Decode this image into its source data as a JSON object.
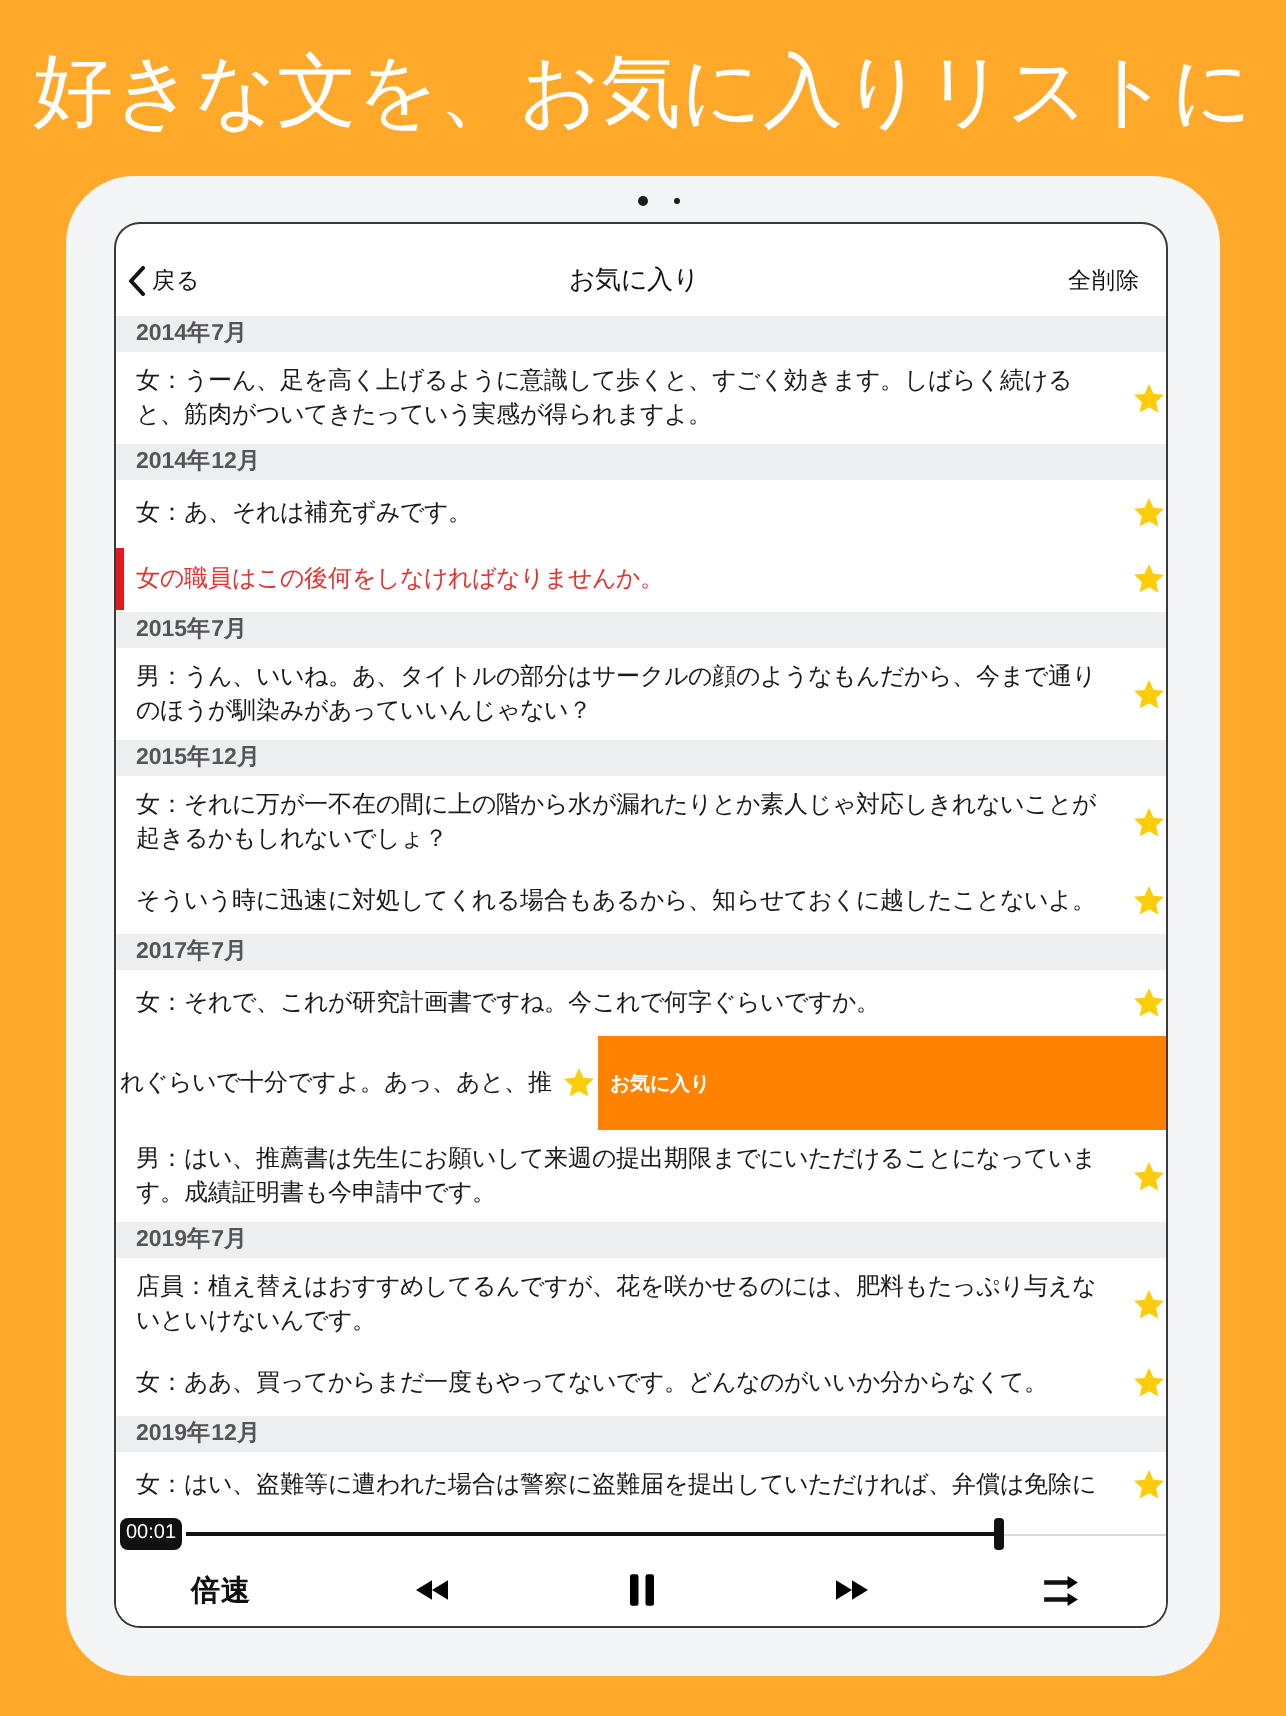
{
  "headline": "好きな文を、お気に入りリストに",
  "nav": {
    "back": "戻る",
    "title": "お気に入り",
    "action": "全削除"
  },
  "sections": [
    {
      "title": "2014年7月",
      "items": [
        {
          "kind": "row",
          "text": "女：うーん、足を高く上げるように意識して歩くと、すごく効きます。しばらく続けると、筋肉がついてきたっていう実感が得られますよ。",
          "favorite": true,
          "playing": false
        }
      ]
    },
    {
      "title": "2014年12月",
      "items": [
        {
          "kind": "row",
          "text": "女：あ、それは補充ずみです。",
          "favorite": true,
          "playing": false
        },
        {
          "kind": "row",
          "text": "女の職員はこの後何をしなければなりませんか。",
          "favorite": true,
          "playing": true
        }
      ]
    },
    {
      "title": "2015年7月",
      "items": [
        {
          "kind": "row",
          "text": "男：うん、いいね。あ、タイトルの部分はサークルの顔のようなもんだから、今まで通りのほうが馴染みがあっていいんじゃない？",
          "favorite": true,
          "playing": false
        }
      ]
    },
    {
      "title": "2015年12月",
      "items": [
        {
          "kind": "row",
          "text": "女：それに万が一不在の間に上の階から水が漏れたりとか素人じゃ対応しきれないことが起きるかもしれないでしょ？",
          "favorite": true,
          "playing": false
        },
        {
          "kind": "row",
          "text": "そういう時に迅速に対処してくれる場合もあるから、知らせておくに越したことないよ。",
          "favorite": true,
          "playing": false
        }
      ]
    },
    {
      "title": "2017年7月",
      "items": [
        {
          "kind": "row",
          "text": "女：それで、これが研究計画書ですね。今これで何字ぐらいですか。",
          "favorite": true,
          "playing": false
        },
        {
          "kind": "swiped",
          "text": "れぐらいで十分ですよ。あっ、あと、推",
          "action": "お気に入り",
          "favorite": true,
          "playing": false
        },
        {
          "kind": "row",
          "text": "男：はい、推薦書は先生にお願いして来週の提出期限までにいただけることになっています。成績証明書も今申請中です。",
          "favorite": true,
          "playing": false
        }
      ]
    },
    {
      "title": "2019年7月",
      "items": [
        {
          "kind": "row",
          "text": "店員：植え替えはおすすめしてるんですが、花を咲かせるのには、肥料もたっぷり与えないといけないんです。",
          "favorite": true,
          "playing": false
        },
        {
          "kind": "row",
          "text": "女：ああ、買ってからまだ一度もやってないです。どんなのがいいか分からなくて。",
          "favorite": true,
          "playing": false
        }
      ]
    },
    {
      "title": "2019年12月",
      "items": [
        {
          "kind": "row",
          "text": "女：はい、盗難等に遭われた場合は警察に盗難届を提出していただければ、弁償は免除に",
          "favorite": true,
          "playing": false
        }
      ]
    }
  ],
  "player": {
    "time": "00:01",
    "level": 0.83,
    "speed": "倍速"
  }
}
